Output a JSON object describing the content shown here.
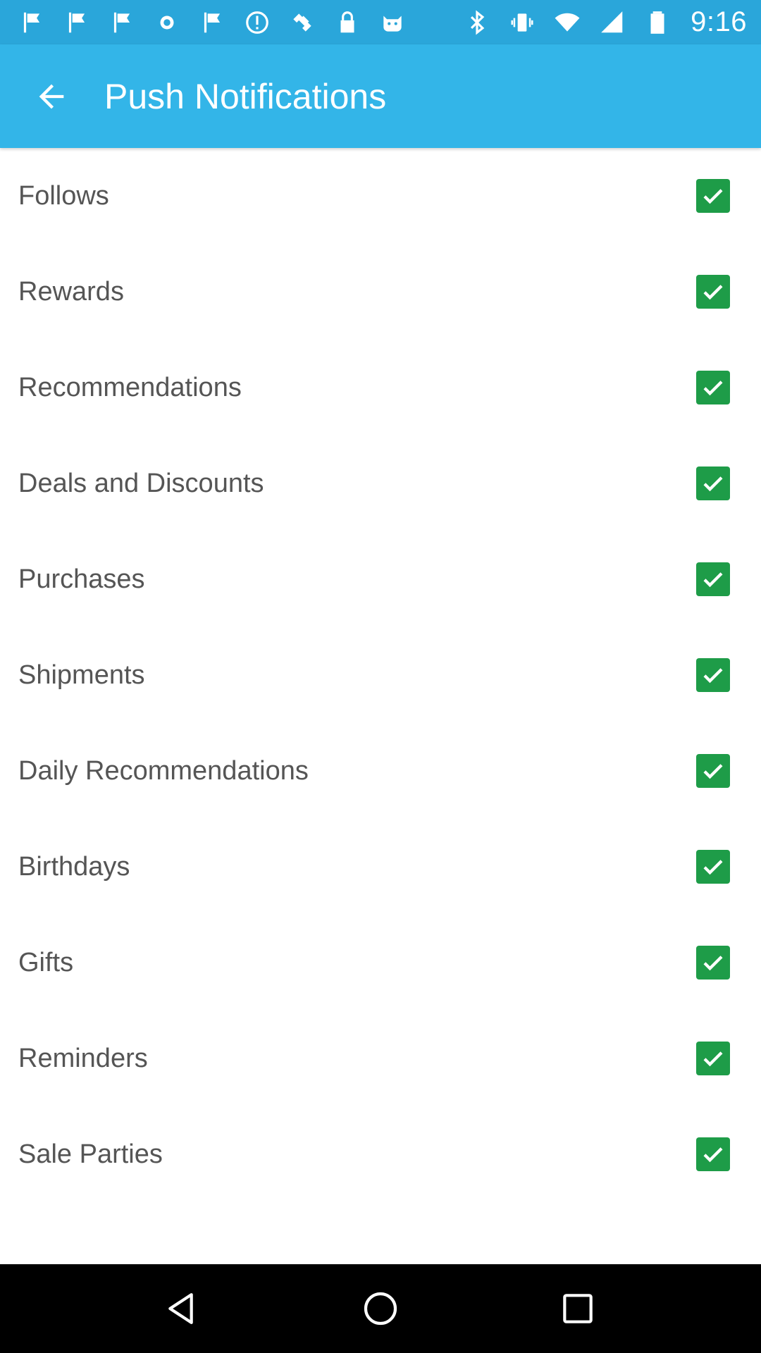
{
  "status_bar": {
    "time": "9:16",
    "left_icons": [
      "flag-icon",
      "flag-icon",
      "flag-icon",
      "dot-icon",
      "flag-icon",
      "alert-icon",
      "satellite-icon",
      "lock-icon",
      "cat-icon"
    ],
    "right_icons": [
      "bluetooth-icon",
      "vibrate-icon",
      "wifi-icon",
      "signal-icon",
      "battery-icon"
    ],
    "background_color": "#2aa6da"
  },
  "app_bar": {
    "title": "Push Notifications",
    "back_icon": "arrow-back-icon",
    "background_color": "#33b5e8"
  },
  "settings": [
    {
      "label": "Follows",
      "checked": true
    },
    {
      "label": "Rewards",
      "checked": true
    },
    {
      "label": "Recommendations",
      "checked": true
    },
    {
      "label": "Deals and Discounts",
      "checked": true
    },
    {
      "label": "Purchases",
      "checked": true
    },
    {
      "label": "Shipments",
      "checked": true
    },
    {
      "label": "Daily Recommendations",
      "checked": true
    },
    {
      "label": "Birthdays",
      "checked": true
    },
    {
      "label": "Gifts",
      "checked": true
    },
    {
      "label": "Reminders",
      "checked": true
    },
    {
      "label": "Sale Parties",
      "checked": true
    }
  ],
  "checkbox_color": "#1e9c48",
  "nav_bar": {
    "buttons": [
      "back-triangle-icon",
      "home-circle-icon",
      "recents-square-icon"
    ]
  }
}
